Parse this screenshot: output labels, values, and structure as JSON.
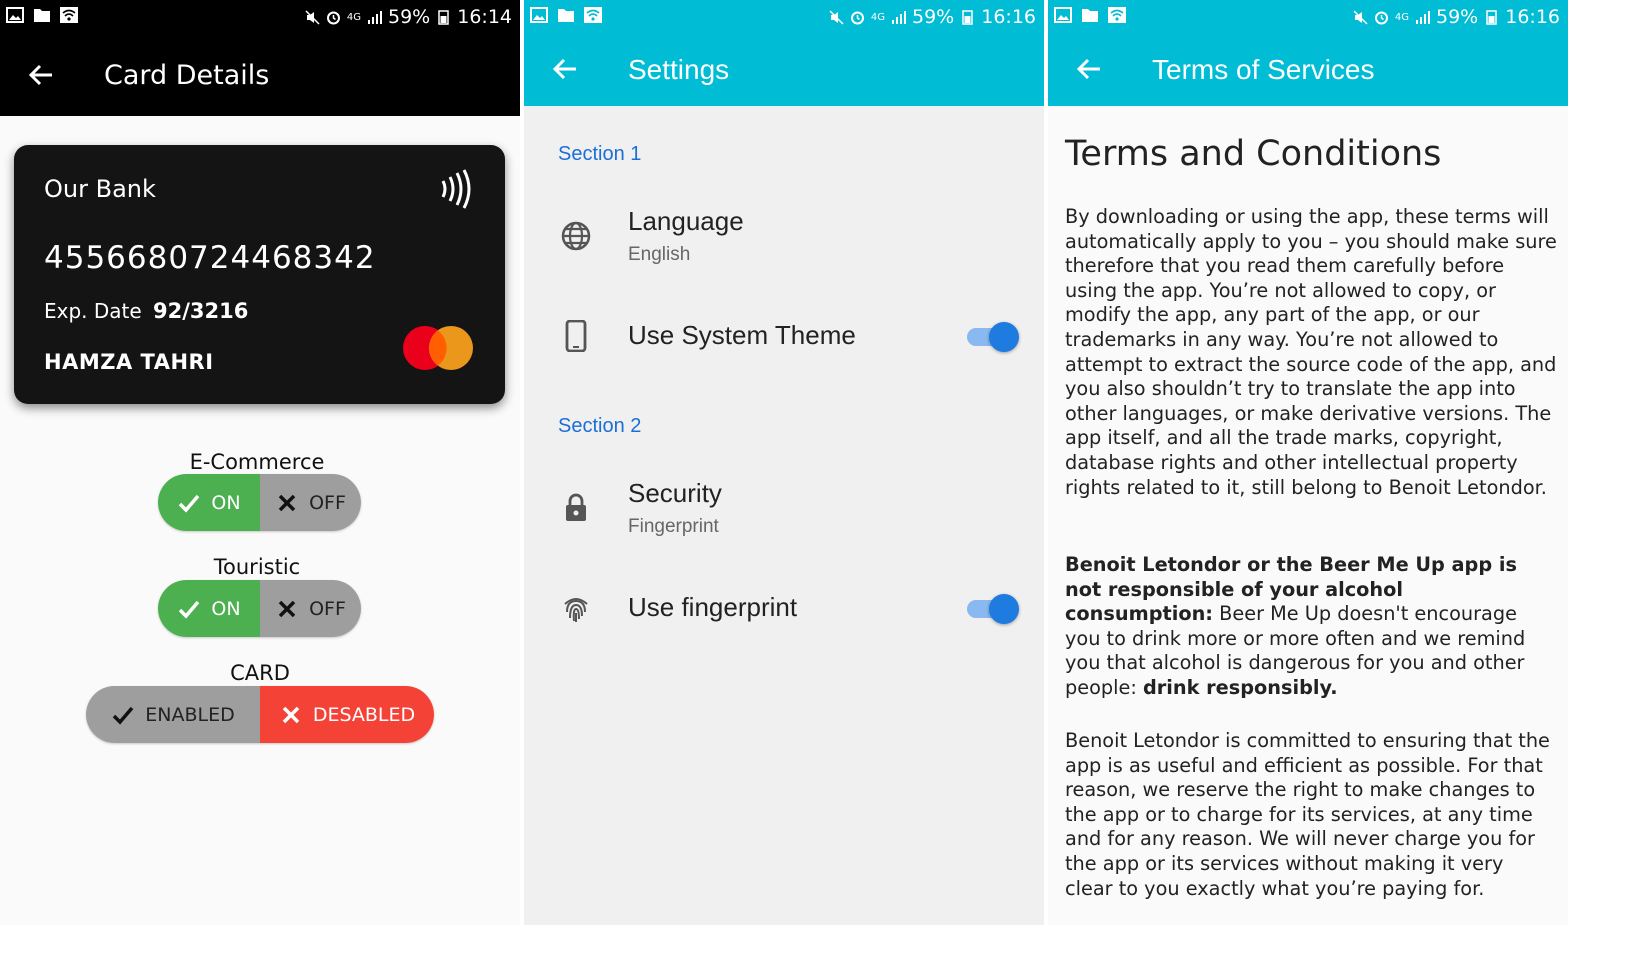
{
  "status": {
    "battery": "59%",
    "network": "4G",
    "time1": "16:14",
    "time2": "16:16",
    "time3": "16:16"
  },
  "screen1": {
    "title": "Card Details",
    "card": {
      "bank": "Our Bank",
      "number": "4556680724468342",
      "exp_label": "Exp. Date",
      "exp_value": "92/3216",
      "holder": "HAMZA TAHRI"
    },
    "ecommerce": {
      "label": "E-Commerce",
      "on": "ON",
      "off": "OFF",
      "selected": "ON"
    },
    "touristic": {
      "label": "Touristic",
      "on": "ON",
      "off": "OFF",
      "selected": "ON"
    },
    "card_state": {
      "label": "CARD",
      "enabled": "ENABLED",
      "disabled": "DESABLED",
      "selected": "DESABLED"
    }
  },
  "screen2": {
    "title": "Settings",
    "section1": "Section 1",
    "language": {
      "title": "Language",
      "value": "English"
    },
    "system_theme": {
      "title": "Use System Theme",
      "checked": true
    },
    "section2": "Section 2",
    "security": {
      "title": "Security",
      "value": "Fingerprint"
    },
    "fingerprint": {
      "title": "Use fingerprint",
      "checked": true
    }
  },
  "screen3": {
    "title": "Terms of Services",
    "heading": "Terms and Conditions",
    "p1": "By downloading or using the app, these terms will automatically apply to you – you should make sure therefore that you read them carefully before using the app. You’re not allowed to copy, or modify the app, any part of the app, or our trademarks in any way. You’re not allowed to attempt to extract the source code of the app, and you also shouldn’t try to translate the app into other languages, or make derivative versions. The app itself, and all the trade marks, copyright, database rights and other intellectual property rights related to it, still belong to Benoit Letondor.",
    "p2_bold": "Benoit Letondor or the Beer Me Up app is not responsible of your alcohol consumption:",
    "p2_text": " Beer Me Up doesn't encourage you to drink more or more often and we remind you that alcohol is dangerous for you and other people: ",
    "p2_bold_end": "drink responsibly.",
    "p3": "Benoit Letondor is committed to ensuring that the app is as useful and efficient as possible. For that reason, we reserve the right to make changes to the app or to charge for its services, at any time and for any reason. We will never charge you for the app or its services without making it very clear to you exactly what you’re paying for."
  },
  "colors": {
    "accent_cyan": "#00bcd4",
    "on_green": "#4caf50",
    "off_grey": "#9e9e9e",
    "disabled_red": "#f44336",
    "switch_blue": "#1e7be0",
    "section_blue": "#1a6fd6"
  },
  "icons": [
    "image-icon",
    "folder-icon",
    "wifi-icon",
    "silent-icon",
    "alarm-icon",
    "signal-icon",
    "battery-icon",
    "back-arrow-icon",
    "contactless-icon",
    "mastercard-logo",
    "check-icon",
    "close-icon",
    "globe-icon",
    "phone-icon",
    "lock-icon",
    "fingerprint-icon"
  ]
}
